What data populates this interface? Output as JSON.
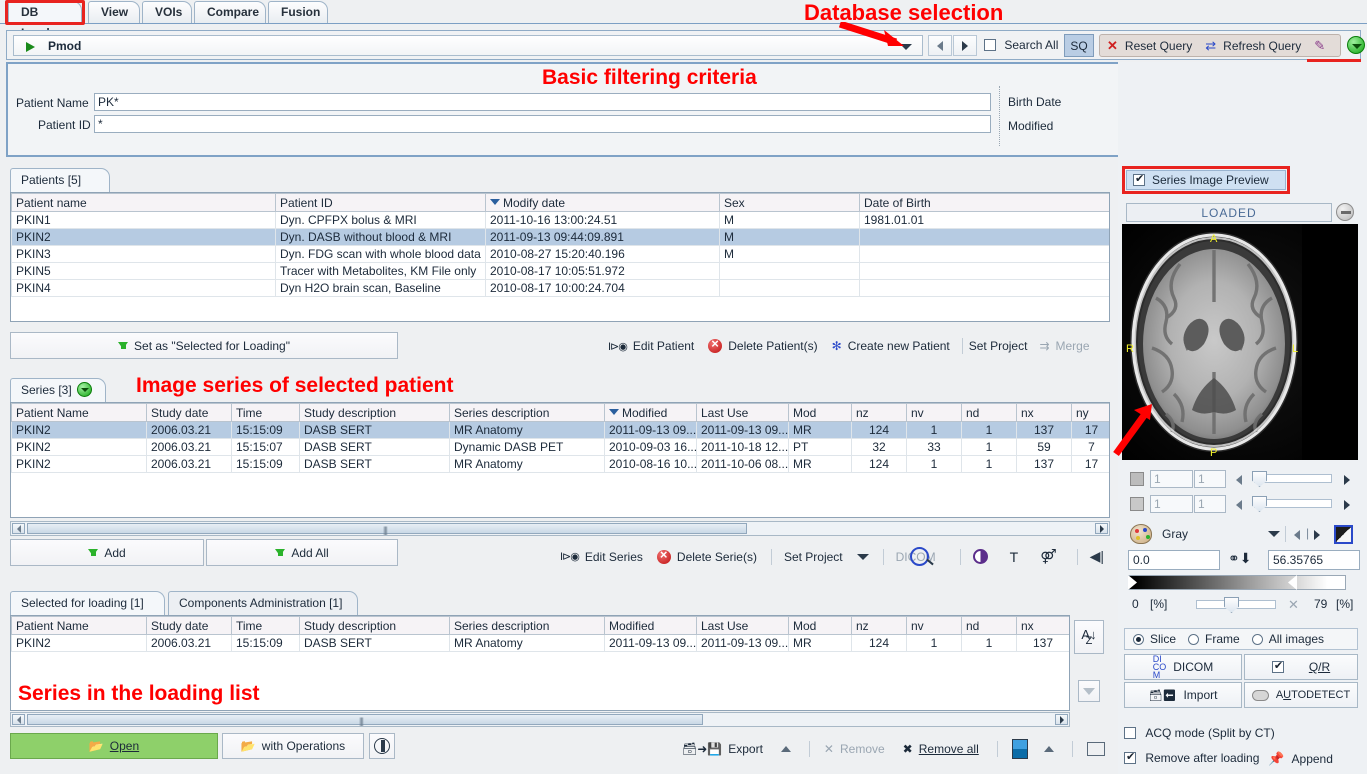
{
  "tabs": [
    {
      "label": "DB Load",
      "selected": true
    },
    {
      "label": "View",
      "selected": false
    },
    {
      "label": "VOIs",
      "selected": false
    },
    {
      "label": "Compare",
      "selected": false
    },
    {
      "label": "Fusion",
      "selected": false
    }
  ],
  "annotations": [
    {
      "text": "Database selection"
    },
    {
      "text": "Basic filtering criteria"
    },
    {
      "text": "Image series of selected patient"
    },
    {
      "text": "Series in the loading list"
    }
  ],
  "dbbar": {
    "database": "Pmod",
    "search_all": "Search All",
    "sq": "SQ",
    "reset_query": "Reset Query",
    "refresh_query": "Refresh Query"
  },
  "filters": {
    "patient_name_label": "Patient Name",
    "patient_name_value": "PK*",
    "patient_id_label": "Patient ID",
    "patient_id_value": "*",
    "birth_date_label": "Birth Date",
    "modified_label": "Modified",
    "date_sep_dot": ".",
    "date_sep_colon": ":"
  },
  "patients": {
    "tab_label": "Patients [5]",
    "columns": [
      "Patient name",
      "Patient ID",
      "Modify date",
      "Sex",
      "Date of Birth"
    ],
    "sorted_column": "Modify date",
    "rows": [
      {
        "name": "PKIN1",
        "id": "Dyn. CPFPX bolus & MRI",
        "modify": "2011-10-16 13:00:24.51",
        "sex": "M",
        "dob": "1981.01.01",
        "selected": false
      },
      {
        "name": "PKIN2",
        "id": "Dyn. DASB without blood & MRI",
        "modify": "2011-09-13 09:44:09.891",
        "sex": "M",
        "dob": "",
        "selected": true
      },
      {
        "name": "PKIN3",
        "id": "Dyn. FDG scan with whole blood data",
        "modify": "2010-08-27 15:20:40.196",
        "sex": "M",
        "dob": "",
        "selected": false
      },
      {
        "name": "PKIN5",
        "id": "Tracer with Metabolites, KM File only",
        "modify": "2010-08-17 10:05:51.972",
        "sex": "",
        "dob": "",
        "selected": false
      },
      {
        "name": "PKIN4",
        "id": "Dyn H2O brain scan, Baseline",
        "modify": "2010-08-17 10:00:24.704",
        "sex": "",
        "dob": "",
        "selected": false
      }
    ],
    "set_selected_button": "Set as \"Selected for Loading\"",
    "tools": [
      "Edit Patient",
      "Delete Patient(s)",
      "Create new Patient",
      "Set Project",
      "Merge"
    ]
  },
  "series": {
    "tab_label": "Series [3]",
    "columns": [
      "Patient Name",
      "Study date",
      "Time",
      "Study description",
      "Series description",
      "Modified",
      "Last Use",
      "Mod",
      "nz",
      "nv",
      "nd",
      "nx",
      "ny"
    ],
    "sorted_column": "Modified",
    "rows": [
      {
        "patient": "PKIN2",
        "study_date": "2006.03.21",
        "time": "15:15:09",
        "study_desc": "DASB SERT",
        "series_desc": "MR Anatomy",
        "modified": "2011-09-13 09...",
        "last_use": "2011-09-13 09...",
        "mod": "MR",
        "nz": "124",
        "nv": "1",
        "nd": "1",
        "nx": "137",
        "ny": "17",
        "selected": true
      },
      {
        "patient": "PKIN2",
        "study_date": "2006.03.21",
        "time": "15:15:07",
        "study_desc": "DASB SERT",
        "series_desc": "Dynamic DASB PET",
        "modified": "2010-09-03 16...",
        "last_use": "2011-10-18 12...",
        "mod": "PT",
        "nz": "32",
        "nv": "33",
        "nd": "1",
        "nx": "59",
        "ny": "7",
        "selected": false
      },
      {
        "patient": "PKIN2",
        "study_date": "2006.03.21",
        "time": "15:15:09",
        "study_desc": "DASB SERT",
        "series_desc": "MR Anatomy",
        "modified": "2010-08-16 10...",
        "last_use": "2011-10-06 08...",
        "mod": "MR",
        "nz": "124",
        "nv": "1",
        "nd": "1",
        "nx": "137",
        "ny": "17",
        "selected": false
      }
    ],
    "add_button": "Add",
    "add_all_button": "Add All",
    "tools": [
      "Edit Series",
      "Delete Serie(s)",
      "Set Project",
      "DICOM",
      "T"
    ]
  },
  "loading": {
    "tabs": [
      {
        "label": "Selected for loading [1]",
        "selected": true
      },
      {
        "label": "Components Administration [1]",
        "selected": false
      }
    ],
    "columns": [
      "Patient Name",
      "Study date",
      "Time",
      "Study description",
      "Series description",
      "Modified",
      "Last Use",
      "Mod",
      "nz",
      "nv",
      "nd",
      "nx"
    ],
    "rows": [
      {
        "patient": "PKIN2",
        "study_date": "2006.03.21",
        "time": "15:15:09",
        "study_desc": "DASB SERT",
        "series_desc": "MR Anatomy",
        "modified": "2011-09-13 09...",
        "last_use": "2011-09-13 09...",
        "mod": "MR",
        "nz": "124",
        "nv": "1",
        "nd": "1",
        "nx": "137"
      }
    ],
    "sort_button": "AZ-sort"
  },
  "bottombar": {
    "open": "Open",
    "with_operations": "with Operations",
    "export": "Export",
    "remove": "Remove",
    "remove_all": "Remove all"
  },
  "preview": {
    "checkbox_label": "Series Image Preview",
    "checkbox_checked": true,
    "status": "LOADED",
    "orientation": {
      "anterior": "A",
      "posterior": "P",
      "right": "R",
      "left": "L"
    },
    "slice_value_1": "1",
    "slice_max_1": "1",
    "slice_value_2": "1",
    "slice_max_2": "1",
    "colormap": "Gray",
    "min_value": "0.0",
    "max_value": "56.35765",
    "pct_min": "0",
    "pct_max": "79",
    "pct_unit": "[%]",
    "modes": [
      {
        "label": "Slice",
        "selected": true
      },
      {
        "label": "Frame",
        "selected": false
      },
      {
        "label": "All images",
        "selected": false
      }
    ],
    "dicom_button": "DICOM",
    "qr_button": "Q/R",
    "qr_checked": true,
    "import_button": "Import",
    "autodetect_button": "AUTODETECT",
    "acq_mode_label": "ACQ mode (Split by CT)",
    "acq_mode_checked": false,
    "remove_after_loading_label": "Remove after loading",
    "remove_after_loading_checked": true,
    "append_label": "Append"
  },
  "colors": {
    "accent_blue": "#b6cbe2",
    "annotation_red": "#ff0000",
    "highlight_red": "#e8231f",
    "green_button": "#8ed06a"
  }
}
